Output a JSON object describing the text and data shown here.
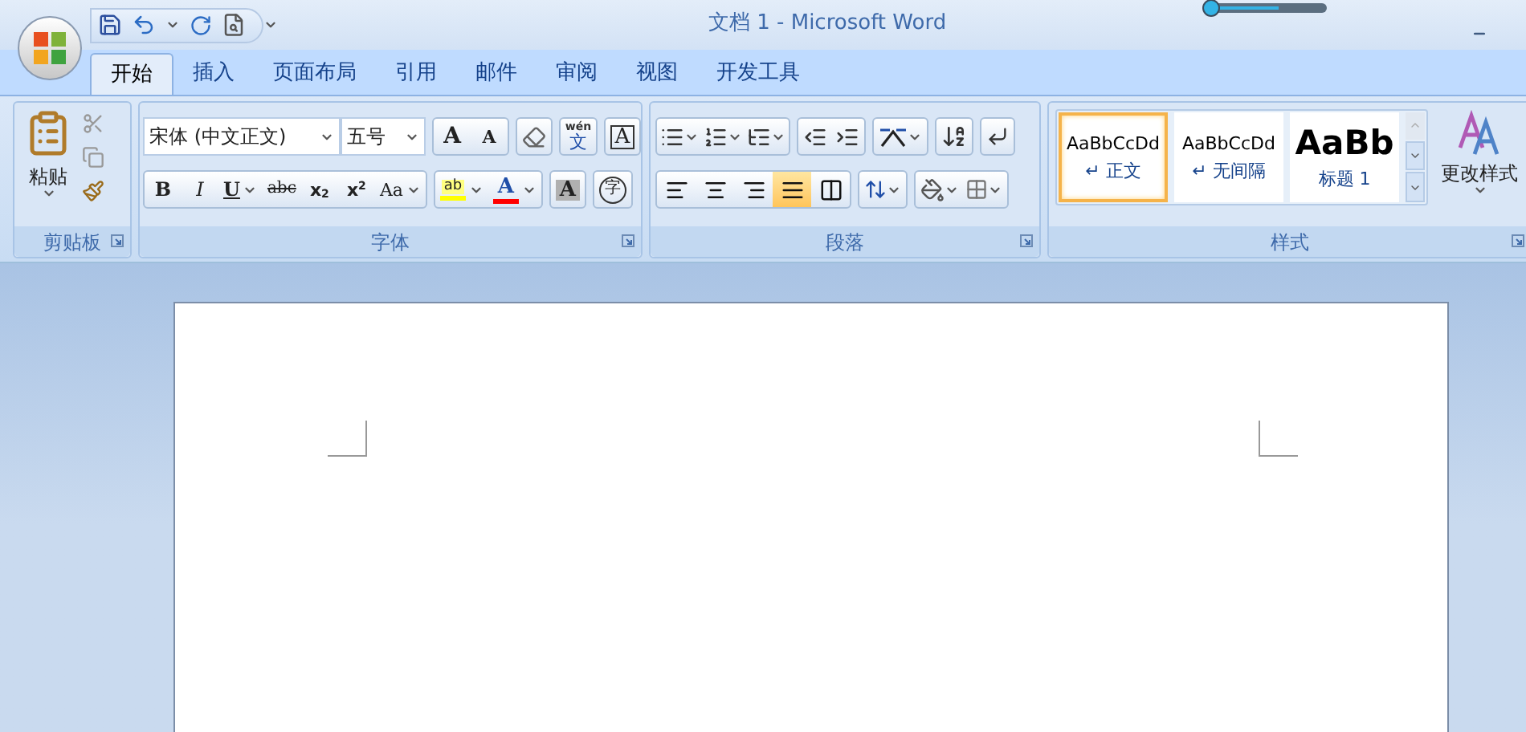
{
  "window": {
    "title": "文档 1 - Microsoft Word"
  },
  "tabs": [
    {
      "label": "开始",
      "selected": true
    },
    {
      "label": "插入",
      "selected": false
    },
    {
      "label": "页面布局",
      "selected": false
    },
    {
      "label": "引用",
      "selected": false
    },
    {
      "label": "邮件",
      "selected": false
    },
    {
      "label": "审阅",
      "selected": false
    },
    {
      "label": "视图",
      "selected": false
    },
    {
      "label": "开发工具",
      "selected": false
    }
  ],
  "clipboard": {
    "group_label": "剪贴板",
    "paste_label": "粘贴"
  },
  "font": {
    "group_label": "字体",
    "font_name": "宋体 (中文正文)",
    "font_size": "五号",
    "row1": [
      {
        "kind": "grow",
        "glyph": "A"
      },
      {
        "kind": "shrink",
        "glyph": "A"
      },
      {
        "kind": "clear"
      },
      {
        "kind": "phonetic",
        "glyph": "文",
        "ruby": "wén"
      },
      {
        "kind": "border",
        "glyph": "A"
      }
    ],
    "row2": [
      {
        "kind": "bold",
        "glyph": "B"
      },
      {
        "kind": "italic",
        "glyph": "I"
      },
      {
        "kind": "underline",
        "glyph": "U",
        "dropdown": true
      },
      {
        "kind": "strike",
        "glyph": "abc"
      },
      {
        "kind": "script",
        "glyph": "x$_{2}$"
      },
      {
        "kind": "script",
        "glyph": "x$^{2}$"
      },
      {
        "kind": "case",
        "glyph": "Aa",
        "dropdown": true
      },
      {
        "kind": "highlight",
        "glyph": "ab",
        "dropdown": true,
        "color": "#ffff00"
      },
      {
        "kind": "color",
        "glyph": "A",
        "dropdown": true,
        "color": "#ff0000"
      },
      {
        "kind": "shade",
        "glyph": "A"
      },
      {
        "kind": "enclose",
        "glyph": "字"
      }
    ]
  },
  "paragraph": {
    "group_label": "段落",
    "alignment": [
      {
        "selected": false
      },
      {
        "selected": false
      },
      {
        "selected": false
      },
      {
        "selected": true
      },
      {
        "selected": false
      }
    ]
  },
  "styles": {
    "group_label": "样式",
    "change_label": "更改样式",
    "gallery": [
      {
        "kind": "body",
        "preview": "AaBbCcDd",
        "label": "↵ 正文",
        "selected": true
      },
      {
        "kind": "body",
        "preview": "AaBbCcDd",
        "label": "↵ 无间隔",
        "selected": false
      },
      {
        "kind": "heading",
        "preview": "AaBb",
        "label": "标题 1",
        "selected": false
      }
    ]
  }
}
